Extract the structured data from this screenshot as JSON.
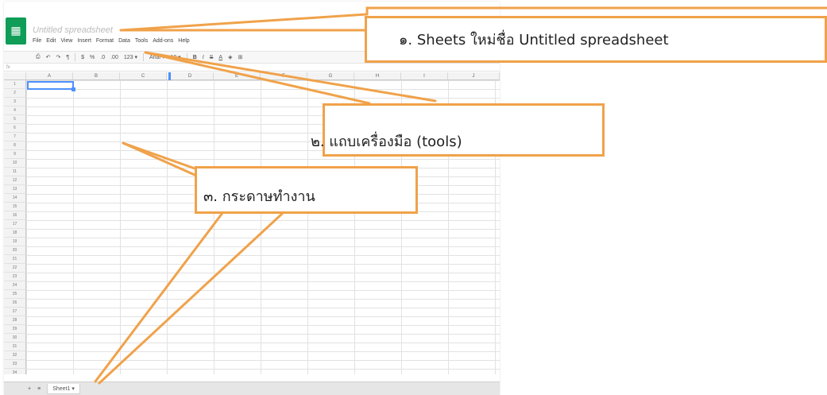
{
  "app": {
    "logo_icon": "spreadsheet-icon",
    "document_title": "Untitled spreadsheet",
    "menu_items": [
      "File",
      "Edit",
      "View",
      "Insert",
      "Format",
      "Data",
      "Tools",
      "Add-ons",
      "Help"
    ],
    "toolbar_items": [
      "⎙",
      "↶",
      "↷",
      "¶",
      "$",
      "%",
      ".0",
      ".00",
      "123 ▾",
      "Arial ▾",
      "10 ▾",
      "B",
      "I",
      "S",
      "A",
      "◈",
      "⊞"
    ],
    "formula_label": "fx",
    "columns": [
      "A",
      "B",
      "C",
      "D",
      "E",
      "F",
      "G",
      "H",
      "I",
      "J"
    ],
    "rows": [
      "1",
      "2",
      "3",
      "4",
      "5",
      "6",
      "7",
      "8",
      "9",
      "10",
      "11",
      "12",
      "13",
      "14",
      "15",
      "16",
      "17",
      "18",
      "19",
      "20",
      "21",
      "22",
      "23",
      "24",
      "25",
      "26",
      "27",
      "28",
      "29",
      "30",
      "31",
      "32",
      "33",
      "34"
    ],
    "sheet_tabs": {
      "add_label": "+",
      "list_label": "≡",
      "active_tab": "Sheet1 ▾"
    }
  },
  "callouts": {
    "one": "๑. Sheets ใหม่ชื่อ Untitled spreadsheet",
    "two": "๒. แถบเครื่องมือ (tools)",
    "three": "๓. กระดาษทำงาน"
  },
  "colors": {
    "accent_orange": "#f0a24a",
    "sheets_green": "#0f9d58",
    "selection_blue": "#4d90fe"
  }
}
